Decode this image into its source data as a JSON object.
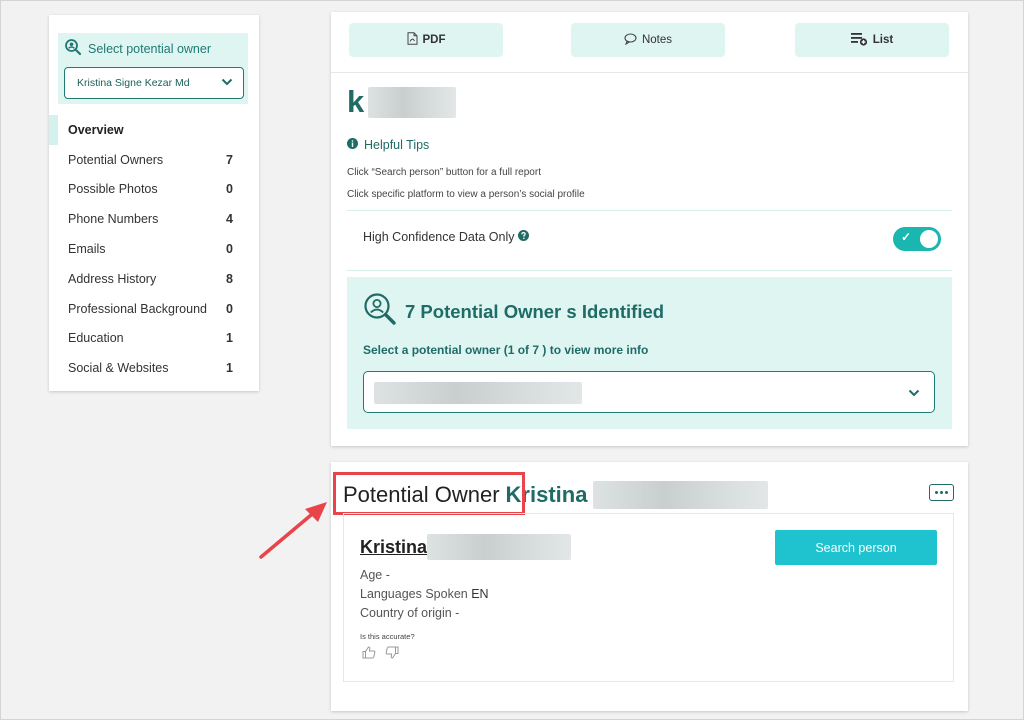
{
  "sidebar": {
    "select_owner_label": "Select potential owner",
    "selected_owner": "Kristina Signe Kezar Md",
    "items": [
      {
        "label": "Overview",
        "count": ""
      },
      {
        "label": "Potential Owners",
        "count": "7"
      },
      {
        "label": "Possible Photos",
        "count": "0"
      },
      {
        "label": "Phone Numbers",
        "count": "4"
      },
      {
        "label": "Emails",
        "count": "0"
      },
      {
        "label": "Address History",
        "count": "8"
      },
      {
        "label": "Professional Background",
        "count": "0"
      },
      {
        "label": "Education",
        "count": "1"
      },
      {
        "label": "Social & Websites",
        "count": "1"
      }
    ]
  },
  "toolbar": {
    "pdf_label": "PDF",
    "notes_label": "Notes",
    "list_label": "List"
  },
  "header": {
    "name_initial": "k"
  },
  "tips": {
    "title": "Helpful Tips",
    "line1": "Click “Search person” button for a full report",
    "line2": "Click specific platform to view a person’s social profile"
  },
  "filter": {
    "label": "High Confidence Data Only",
    "toggle_mark": "✓",
    "enabled": true
  },
  "owners": {
    "title": "7 Potential Owner s Identified",
    "subtitle": "Select a potential owner (1 of 7 ) to view more info"
  },
  "owner_card": {
    "label": "Potential Owner",
    "first_name": "Kristina",
    "person_name": "Kristina",
    "age": "Age -",
    "languages_label": "Languages Spoken",
    "languages_value": "EN",
    "country": "Country of origin -",
    "accuracy_question": "Is this accurate?",
    "search_button": "Search person"
  },
  "colors": {
    "accent_teal": "#1f6b66",
    "light_teal": "#dff5f2",
    "button_cyan": "#1ec3cf",
    "highlight_red": "#e8454a"
  }
}
